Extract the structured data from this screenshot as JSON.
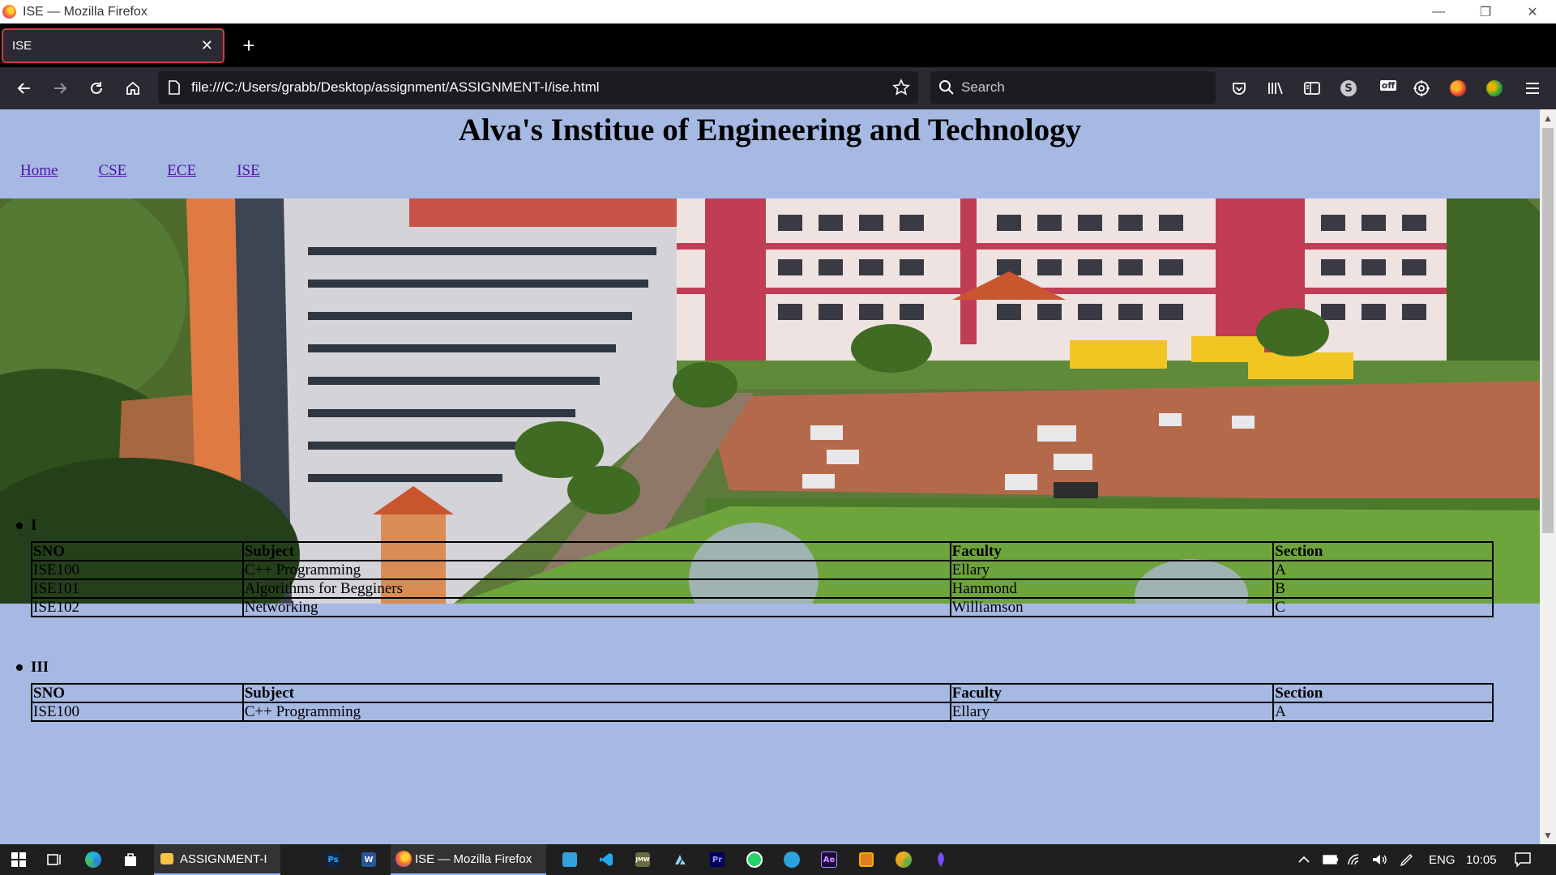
{
  "window": {
    "title": "ISE — Mozilla Firefox",
    "controls": [
      "minimize-icon",
      "restore-icon",
      "close-icon"
    ]
  },
  "tabs": [
    {
      "label": "ISE",
      "active": true
    }
  ],
  "toolbar": {
    "url": "file:///C:/Users/grabb/Desktop/assignment/ASSIGNMENT-I/ise.html",
    "search_placeholder": "Search",
    "extensions": [
      "pocket-icon",
      "library-icon",
      "sidebar-icon",
      "skype-icon",
      "off-extension-icon",
      "settings-extension-icon",
      "colorful-extension-icon",
      "green-extension-icon",
      "menu-icon"
    ],
    "off_badge": "off"
  },
  "page": {
    "heading": "Alva's Institue of Engineering and Technology",
    "nav": [
      "Home",
      "CSE",
      "ECE",
      "ISE"
    ],
    "hero_image": "campus-photo",
    "semesters": [
      {
        "title": "I",
        "headers": [
          "SNO",
          "Subject",
          "Faculty",
          "Section"
        ],
        "rows": [
          [
            "ISE100",
            "C++ Programming",
            "Ellary",
            "A"
          ],
          [
            "ISE101",
            "Algorithms for Begginers",
            "Hammond",
            "B"
          ],
          [
            "ISE102",
            "Networking",
            "Williamson",
            "C"
          ]
        ]
      },
      {
        "title": "III",
        "headers": [
          "SNO",
          "Subject",
          "Faculty",
          "Section"
        ],
        "rows": [
          [
            "ISE100",
            "C++ Programming",
            "Ellary",
            "A"
          ]
        ]
      }
    ]
  },
  "taskbar": {
    "items": [
      {
        "icon": "windows-start-icon"
      },
      {
        "icon": "task-view-icon"
      },
      {
        "icon": "edge-icon"
      },
      {
        "icon": "store-icon"
      },
      {
        "icon": "file-explorer-icon",
        "label": "ASSIGNMENT-I"
      },
      {
        "icon": "photoshop-icon",
        "text": "Ps"
      },
      {
        "icon": "word-icon",
        "text": "W"
      },
      {
        "icon": "firefox-icon",
        "label": "ISE — Mozilla Firefox"
      },
      {
        "icon": "vscode-alt-icon"
      },
      {
        "icon": "vscode-icon"
      },
      {
        "icon": "jmw-icon",
        "text": "JMW"
      },
      {
        "icon": "azure-icon"
      },
      {
        "icon": "premiere-icon",
        "text": "Pr"
      },
      {
        "icon": "whatsapp-icon"
      },
      {
        "icon": "telegram-icon"
      },
      {
        "icon": "after-effects-icon",
        "text": "Ae"
      },
      {
        "icon": "office-icon"
      },
      {
        "icon": "chrome-canary-icon"
      },
      {
        "icon": "feather-icon"
      }
    ],
    "tray": {
      "language": "ENG",
      "time": "10:05"
    }
  }
}
